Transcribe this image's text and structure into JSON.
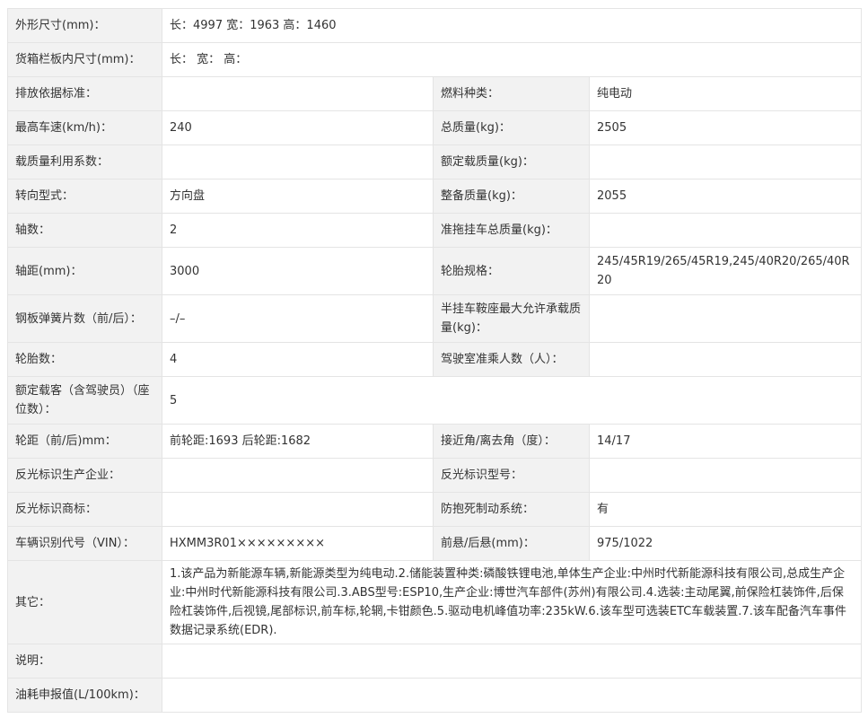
{
  "rows": [
    {
      "cells": [
        {
          "t": "l",
          "v": "外形尺寸(mm)："
        },
        {
          "t": "v",
          "span": 3,
          "v": "长：4997 宽：1963 高：1460"
        }
      ]
    },
    {
      "cells": [
        {
          "t": "l",
          "v": "货箱栏板内尺寸(mm)："
        },
        {
          "t": "v",
          "span": 3,
          "v": "长： 宽： 高："
        }
      ]
    },
    {
      "cells": [
        {
          "t": "l",
          "v": "排放依据标准："
        },
        {
          "t": "v",
          "v": ""
        },
        {
          "t": "l",
          "v": "燃料种类："
        },
        {
          "t": "v",
          "v": "纯电动"
        }
      ]
    },
    {
      "cells": [
        {
          "t": "l",
          "v": "最高车速(km/h)："
        },
        {
          "t": "v",
          "v": "240"
        },
        {
          "t": "l",
          "v": "总质量(kg)："
        },
        {
          "t": "v",
          "v": "2505"
        }
      ]
    },
    {
      "cells": [
        {
          "t": "l",
          "v": "载质量利用系数："
        },
        {
          "t": "v",
          "v": ""
        },
        {
          "t": "l",
          "v": "额定载质量(kg)："
        },
        {
          "t": "v",
          "v": ""
        }
      ]
    },
    {
      "cells": [
        {
          "t": "l",
          "v": "转向型式："
        },
        {
          "t": "v",
          "v": "方向盘"
        },
        {
          "t": "l",
          "v": "整备质量(kg)："
        },
        {
          "t": "v",
          "v": "2055"
        }
      ]
    },
    {
      "cells": [
        {
          "t": "l",
          "v": "轴数："
        },
        {
          "t": "v",
          "v": "2"
        },
        {
          "t": "l",
          "v": "准拖挂车总质量(kg)："
        },
        {
          "t": "v",
          "v": ""
        }
      ]
    },
    {
      "cells": [
        {
          "t": "l",
          "v": "轴距(mm)："
        },
        {
          "t": "v",
          "v": "3000"
        },
        {
          "t": "l",
          "v": "轮胎规格："
        },
        {
          "t": "v",
          "v": "245/45R19/265/45R19,245/40R20/265/40R20"
        }
      ]
    },
    {
      "cells": [
        {
          "t": "l",
          "v": "钢板弹簧片数（前/后）："
        },
        {
          "t": "v",
          "v": "–/–"
        },
        {
          "t": "l",
          "v": "半挂车鞍座最大允许承载质量(kg)："
        },
        {
          "t": "v",
          "v": ""
        }
      ]
    },
    {
      "cells": [
        {
          "t": "l",
          "v": "轮胎数："
        },
        {
          "t": "v",
          "v": "4"
        },
        {
          "t": "l",
          "v": "驾驶室准乘人数（人）："
        },
        {
          "t": "v",
          "v": ""
        }
      ]
    },
    {
      "cells": [
        {
          "t": "l",
          "v": "额定载客（含驾驶员）（座位数）："
        },
        {
          "t": "v",
          "span": 3,
          "v": "5"
        }
      ]
    },
    {
      "cells": [
        {
          "t": "l",
          "v": "轮距（前/后)mm："
        },
        {
          "t": "v",
          "v": "前轮距:1693 后轮距:1682"
        },
        {
          "t": "l",
          "v": "接近角/离去角（度）："
        },
        {
          "t": "v",
          "v": "14/17"
        }
      ]
    },
    {
      "cells": [
        {
          "t": "l",
          "v": "反光标识生产企业："
        },
        {
          "t": "v",
          "v": ""
        },
        {
          "t": "l",
          "v": "反光标识型号："
        },
        {
          "t": "v",
          "v": ""
        }
      ]
    },
    {
      "cells": [
        {
          "t": "l",
          "v": "反光标识商标："
        },
        {
          "t": "v",
          "v": ""
        },
        {
          "t": "l",
          "v": "防抱死制动系统："
        },
        {
          "t": "v",
          "v": "有"
        }
      ]
    },
    {
      "cells": [
        {
          "t": "l",
          "v": "车辆识别代号（VIN）："
        },
        {
          "t": "v",
          "v": "HXMM3R01×××××××××"
        },
        {
          "t": "l",
          "v": "前悬/后悬(mm)："
        },
        {
          "t": "v",
          "v": "975/1022"
        }
      ]
    },
    {
      "cells": [
        {
          "t": "l",
          "v": "其它："
        },
        {
          "t": "v",
          "span": 3,
          "v": "1.该产品为新能源车辆,新能源类型为纯电动.2.储能装置种类:磷酸铁锂电池,单体生产企业:中州时代新能源科技有限公司,总成生产企业:中州时代新能源科技有限公司.3.ABS型号:ESP10,生产企业:博世汽车部件(苏州)有限公司.4.选装:主动尾翼,前保险杠装饰件,后保险杠装饰件,后视镜,尾部标识,前车标,轮辋,卡钳颜色.5.驱动电机峰值功率:235kW.6.该车型可选装ETC车载装置.7.该车配备汽车事件数据记录系统(EDR)."
        }
      ]
    },
    {
      "cells": [
        {
          "t": "l",
          "v": "说明："
        },
        {
          "t": "v",
          "span": 3,
          "v": ""
        }
      ]
    },
    {
      "cells": [
        {
          "t": "l",
          "v": "油耗申报值(L/100km)："
        },
        {
          "t": "v",
          "span": 3,
          "v": ""
        }
      ]
    }
  ]
}
